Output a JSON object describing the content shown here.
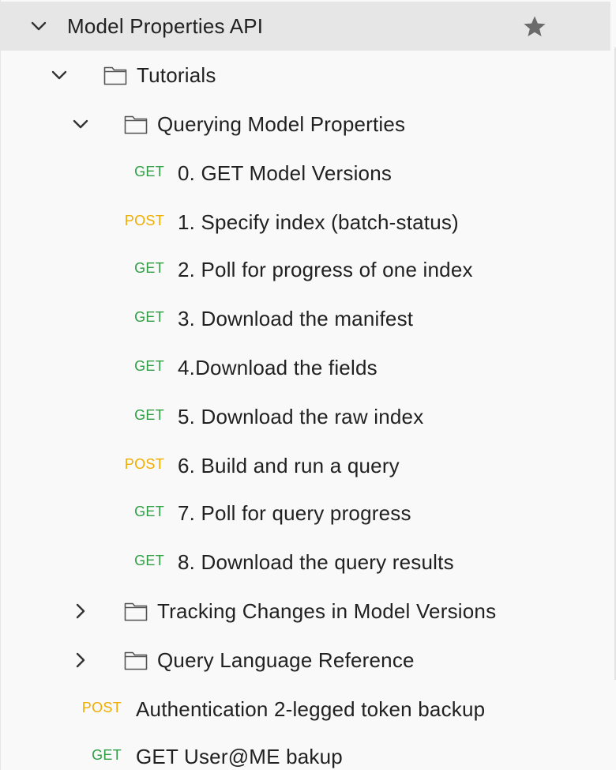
{
  "collection": {
    "name": "Model Properties API",
    "starred": true
  },
  "folders": {
    "tutorials": "Tutorials",
    "querying": "Querying Model Properties",
    "tracking": "Tracking Changes in Model Versions",
    "query_language": "Query Language Reference"
  },
  "requests": [
    {
      "method": "GET",
      "name": "0. GET Model Versions"
    },
    {
      "method": "POST",
      "name": "1. Specify index (batch-status)"
    },
    {
      "method": "GET",
      "name": "2. Poll for progress of one index"
    },
    {
      "method": "GET",
      "name": "3. Download the manifest"
    },
    {
      "method": "GET",
      "name": "4.Download the fields"
    },
    {
      "method": "GET",
      "name": "5. Download the raw index"
    },
    {
      "method": "POST",
      "name": "6. Build and run a query"
    },
    {
      "method": "GET",
      "name": "7. Poll for query progress"
    },
    {
      "method": "GET",
      "name": "8. Download the query results"
    }
  ],
  "root_requests": [
    {
      "method": "POST",
      "name": "Authentication 2-legged token backup"
    },
    {
      "method": "GET",
      "name": "GET User@ME bakup"
    }
  ],
  "colors": {
    "get": "#2f9e44",
    "post": "#f0ad00",
    "selected_row": "#e6e6e6",
    "background": "#f9f9f9"
  },
  "icons": {
    "expanded": "chevron-down-icon",
    "collapsed": "chevron-right-icon",
    "folder": "folder-icon",
    "star": "star-icon"
  }
}
